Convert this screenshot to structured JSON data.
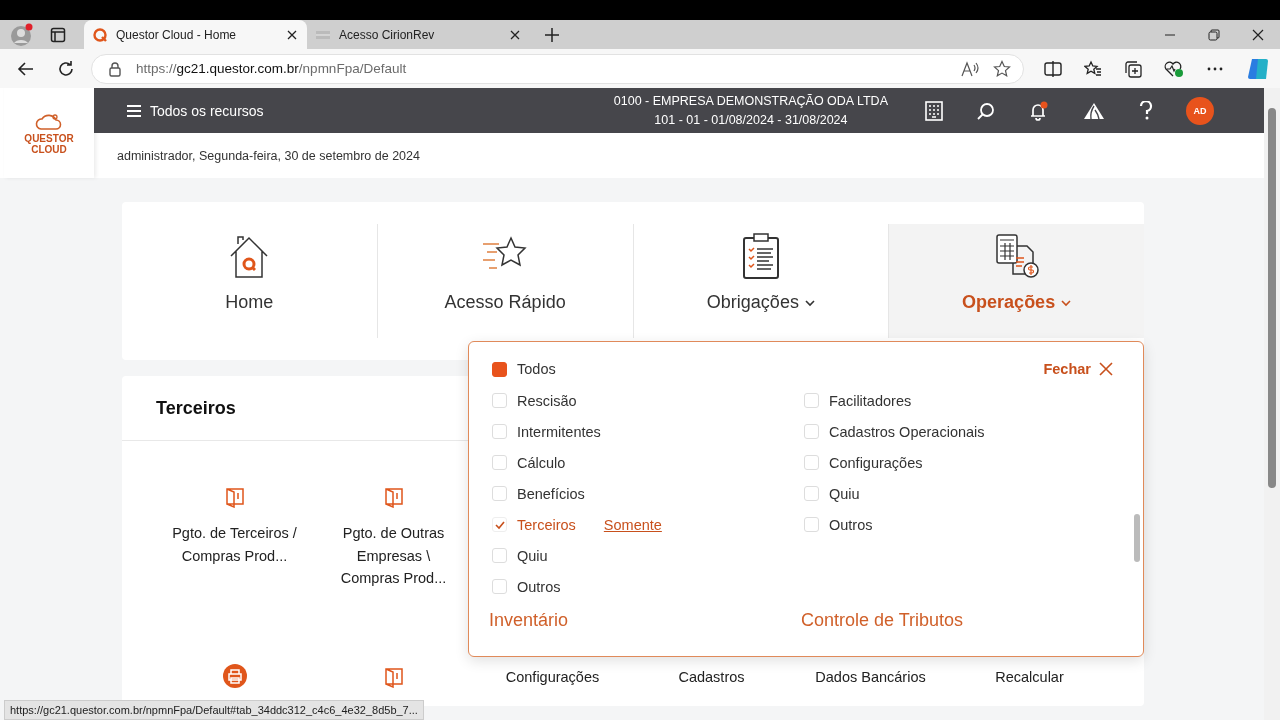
{
  "browser": {
    "tabs": [
      {
        "title": "Questor Cloud - Home",
        "selected": true
      },
      {
        "title": "Acesso CirionRev",
        "selected": false
      }
    ],
    "address": {
      "prefix": "https://",
      "host": "gc21.questor.com.br",
      "path": "/npmnFpa/Default"
    }
  },
  "app": {
    "logo": {
      "line1": "QUESTOR",
      "line2": "CLOUD"
    },
    "menu_label": "Todos os recursos",
    "company": "0100 - EMPRESA DEMONSTRAÇÃO ODA LTDA",
    "period": "101 - 01 - 01/08/2024 - 31/08/2024",
    "avatar": "AD",
    "notification_badge": true,
    "greeting": "administrador, Segunda-feira, 30 de setembro de 2024"
  },
  "nav_tabs": [
    {
      "label": "Home",
      "kind": "home",
      "dropdown": false,
      "selected": false
    },
    {
      "label": "Acesso Rápido",
      "kind": "star",
      "dropdown": false,
      "selected": false
    },
    {
      "label": "Obrigações",
      "kind": "clipboard",
      "dropdown": true,
      "selected": false
    },
    {
      "label": "Operações",
      "kind": "calculator",
      "dropdown": true,
      "selected": true
    }
  ],
  "terceiros": {
    "title": "Terceiros",
    "rows": [
      [
        {
          "label": "Pgto. de Terceiros / Compras Prod...",
          "kind": "door"
        },
        {
          "label": "Pgto. de Outras Empresas \\ Compras Prod...",
          "kind": "door"
        }
      ],
      [
        {
          "kind": "printer"
        },
        {
          "kind": "door"
        },
        {
          "label": "Configurações"
        },
        {
          "label": "Cadastros"
        },
        {
          "label": "Dados Bancários"
        },
        {
          "label": "Recalcular"
        }
      ]
    ]
  },
  "filter_popup": {
    "all": {
      "label": "Todos",
      "indeterminate": true
    },
    "close_label": "Fechar",
    "left": [
      {
        "label": "Rescisão",
        "checked": false
      },
      {
        "label": "Intermitentes",
        "checked": false
      },
      {
        "label": "Cálculo",
        "checked": false
      },
      {
        "label": "Benefícios",
        "checked": false
      },
      {
        "label": "Terceiros",
        "checked": true,
        "only_link": "Somente"
      },
      {
        "label": "Quiu",
        "checked": false
      },
      {
        "label": "Outros",
        "checked": false
      }
    ],
    "right": [
      {
        "label": "Facilitadores",
        "checked": false
      },
      {
        "label": "Cadastros Operacionais",
        "checked": false
      },
      {
        "label": "Configurações",
        "checked": false
      },
      {
        "label": "Quiu",
        "checked": false
      },
      {
        "label": "Outros",
        "checked": false
      }
    ],
    "sections": [
      "Inventário",
      "Controle de Tributos"
    ]
  },
  "status_bar": "https://gc21.questor.com.br/npmnFpa/Default#tab_34ddc312_c4c6_4e32_8d5b_7..."
}
